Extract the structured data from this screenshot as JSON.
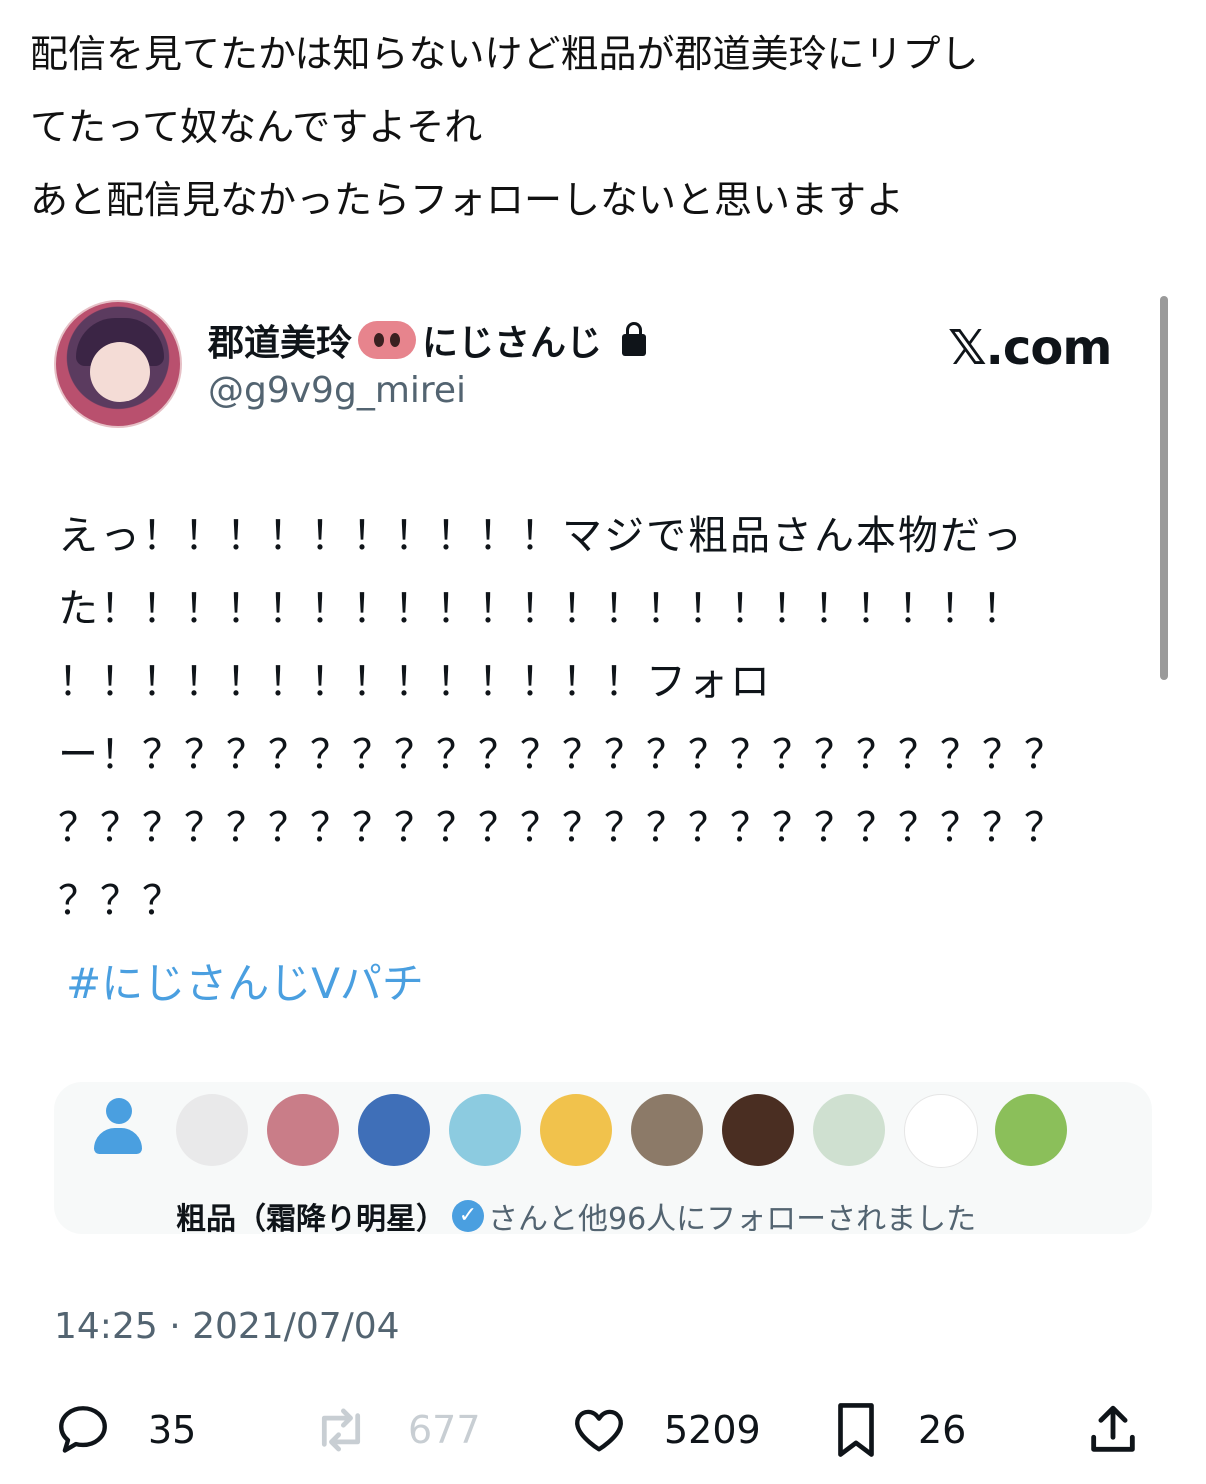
{
  "quote_text": {
    "lines": [
      "配信を見てたかは知らないけど粗品が郡道美玲にリプし",
      "てたって奴なんですよそれ",
      "あと配信見なかったらフォローしないと思いますよ"
    ]
  },
  "embedded_tweet": {
    "author": {
      "name_part1": "郡道美玲",
      "pig_icon": "pig-nose-emoji",
      "name_part2": "にじさんじ",
      "lock_icon": "lock-icon",
      "handle": "@g9v9g_mirei"
    },
    "source": "𝕏.com",
    "body_lines": [
      "えっ！！！！！！！！！！マジで粗品さん本物だっ",
      "た！！！！！！！！！！！！！！！！！！！！！！",
      "！！！！！！！！！！！！！！フォロ",
      "ー！？？？？？？？？？？？？？？？？？？？？？？",
      "？？？？？？？？？？？？？？？？？？？？？？？？",
      "？？？"
    ],
    "hashtag": "#にじさんじVパチ",
    "followed_by": {
      "name": "粗品（霜降り明星）",
      "suffix": "さんと他96人にフォローされました",
      "verified_icon": "verified-check-icon",
      "avatar_colors": [
        "#e9e9ea",
        "#c97d88",
        "#3f6fb8",
        "#8ccbe0",
        "#f1c24c",
        "#8c7a68",
        "#4a2e22",
        "#cfe0d0",
        "#ffffff",
        "#8bbf5a"
      ]
    },
    "timestamp": "14:25 · 2021/07/04",
    "stats": {
      "replies": "35",
      "reposts": "677",
      "likes": "5209",
      "bookmarks": "26"
    }
  }
}
